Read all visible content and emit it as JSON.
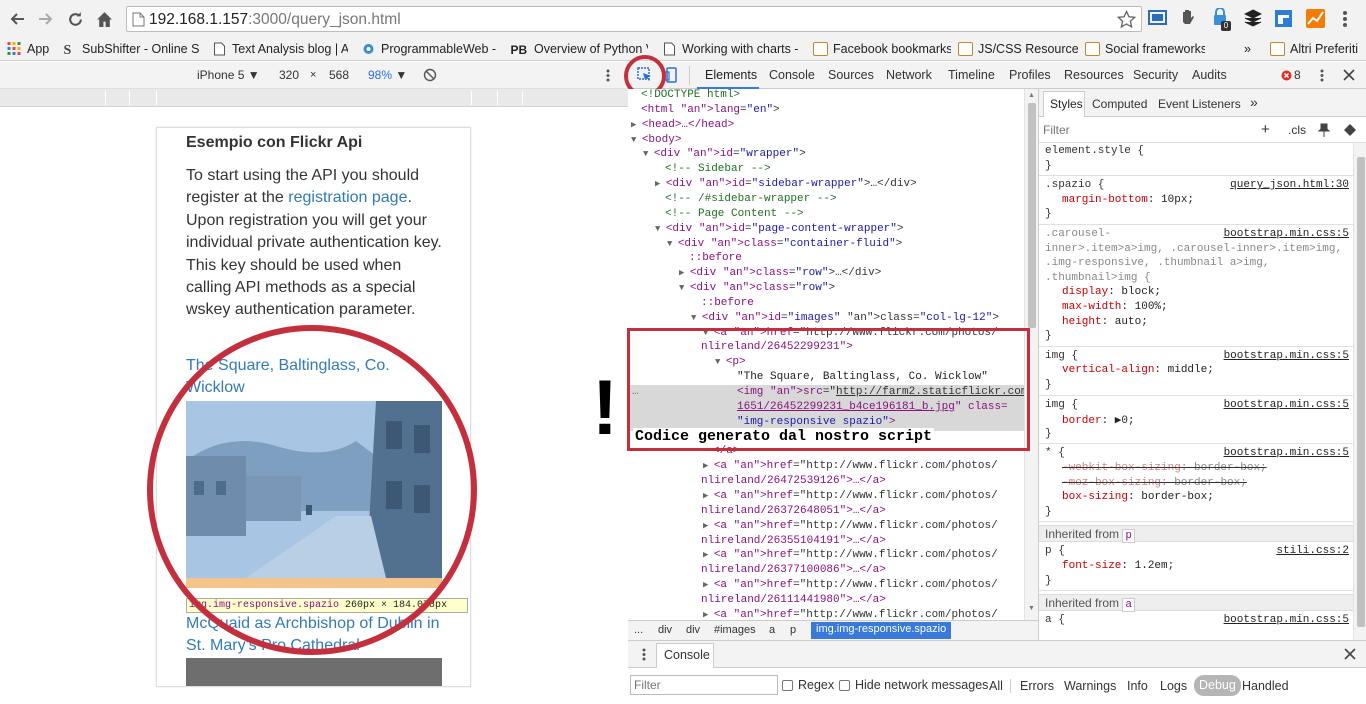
{
  "browser": {
    "url_host": "192.168.1.157",
    "url_path": ":3000/query_json.html",
    "bookmarks": [
      {
        "label": "App",
        "icon": "apps-grid-icon"
      },
      {
        "label": "SubShifter - Online SF",
        "icon": "subshifter-icon"
      },
      {
        "label": "Text Analysis blog | A",
        "icon": "page-icon"
      },
      {
        "label": "ProgrammableWeb -",
        "icon": "gear-icon"
      },
      {
        "label": "Overview of Python V",
        "icon": "pb-icon"
      },
      {
        "label": "Working with charts -",
        "icon": "page-icon"
      },
      {
        "label": "Facebook bookmarks",
        "icon": "folder-icon"
      },
      {
        "label": "JS/CSS Resources",
        "icon": "folder-icon"
      },
      {
        "label": "Social frameworks",
        "icon": "folder-icon"
      },
      {
        "label": "»",
        "icon": ""
      },
      {
        "label": "Altri Preferiti",
        "icon": "folder-icon"
      }
    ],
    "extension_badge": "0"
  },
  "device_toolbar": {
    "device": "iPhone 5",
    "width": "320",
    "times": "×",
    "height": "568",
    "zoom": "98%"
  },
  "page": {
    "heading": "Esempio con Flickr Api",
    "paragraph_before": "To start using the API you should register at the ",
    "registration_link": "registration page",
    "paragraph_after": ". Upon registration you will get your individual private authentication key. This key should be used when calling API methods as a special wskey authentication parameter.",
    "photo1_title": "The Square, Baltinglass, Co. Wicklow",
    "tooltip_selector": "img.img-responsive.spazio",
    "tooltip_size": "260px × 184.078px",
    "photo2_title": "McQuaid as Archbishop of Dublin in St. Mary's Pro Cathedral"
  },
  "devtools": {
    "tabs": [
      "Elements",
      "Console",
      "Sources",
      "Network",
      "Timeline",
      "Profiles",
      "Resources",
      "Security",
      "Audits"
    ],
    "error_count": "8",
    "dom_lines": [
      {
        "indent": 0,
        "tri": "",
        "t": "<!DOCTYPE html>",
        "k": "cm"
      },
      {
        "indent": 0,
        "tri": "",
        "t": "<html lang=\"en\">",
        "k": "tg"
      },
      {
        "indent": 0,
        "tri": "▶",
        "t": "<head>…</head>",
        "k": "tg"
      },
      {
        "indent": 0,
        "tri": "▼",
        "t": "<body>",
        "k": "tg"
      },
      {
        "indent": 1,
        "tri": "▼",
        "t": "<div id=\"wrapper\">",
        "k": "tg"
      },
      {
        "indent": 2,
        "tri": "",
        "t": "<!-- Sidebar -->",
        "k": "cm"
      },
      {
        "indent": 2,
        "tri": "▶",
        "t": "<div id=\"sidebar-wrapper\">…</div>",
        "k": "tg"
      },
      {
        "indent": 2,
        "tri": "",
        "t": "<!-- /#sidebar-wrapper -->",
        "k": "cm"
      },
      {
        "indent": 2,
        "tri": "",
        "t": "<!-- Page Content -->",
        "k": "cm"
      },
      {
        "indent": 2,
        "tri": "▼",
        "t": "<div id=\"page-content-wrapper\">",
        "k": "tg"
      },
      {
        "indent": 3,
        "tri": "▼",
        "t": "<div class=\"container-fluid\">",
        "k": "tg"
      },
      {
        "indent": 4,
        "tri": "",
        "t": "::before",
        "k": "tg"
      },
      {
        "indent": 4,
        "tri": "▶",
        "t": "<div class=\"row\">…</div>",
        "k": "tg"
      },
      {
        "indent": 4,
        "tri": "▼",
        "t": "<div class=\"row\">",
        "k": "tg"
      },
      {
        "indent": 5,
        "tri": "",
        "t": "::before",
        "k": "tg"
      },
      {
        "indent": 5,
        "tri": "▼",
        "t": "<div id=\"images\" class=\"col-lg-12\">",
        "k": "tg"
      },
      {
        "indent": 6,
        "tri": "▼",
        "t": "<a href=\"http://www.flickr.com/photos/",
        "k": "tg"
      },
      {
        "indent": 5,
        "tri": "",
        "t": "nlireland/26452299231\">",
        "k": "tg"
      },
      {
        "indent": 7,
        "tri": "▼",
        "t": "<p>",
        "k": "tg"
      },
      {
        "indent": 8,
        "tri": "",
        "t": "\"The Square, Baltinglass, Co. Wicklow\"",
        "k": "tx"
      },
      {
        "indent": 8,
        "tri": "",
        "t": "<img src=\"http://farm2.staticflickr.com/",
        "k": "tg"
      },
      {
        "indent": 8,
        "tri": "",
        "t": "1651/26452299231_b4ce196181_b.jpg\" class=",
        "k": "tg"
      },
      {
        "indent": 8,
        "tri": "",
        "t": "\"img-responsive spazio\">",
        "k": "tg"
      },
      {
        "indent": 7,
        "tri": "",
        "t": "",
        "k": "tg"
      },
      {
        "indent": 6,
        "tri": "",
        "t": "</a>",
        "k": "tg"
      },
      {
        "indent": 6,
        "tri": "▶",
        "t": "<a href=\"http://www.flickr.com/photos/",
        "k": "tg"
      },
      {
        "indent": 5,
        "tri": "",
        "t": "nlireland/26472539126\">…</a>",
        "k": "tg"
      },
      {
        "indent": 6,
        "tri": "▶",
        "t": "<a href=\"http://www.flickr.com/photos/",
        "k": "tg"
      },
      {
        "indent": 5,
        "tri": "",
        "t": "nlireland/26372648051\">…</a>",
        "k": "tg"
      },
      {
        "indent": 6,
        "tri": "▶",
        "t": "<a href=\"http://www.flickr.com/photos/",
        "k": "tg"
      },
      {
        "indent": 5,
        "tri": "",
        "t": "nlireland/26355104191\">…</a>",
        "k": "tg"
      },
      {
        "indent": 6,
        "tri": "▶",
        "t": "<a href=\"http://www.flickr.com/photos/",
        "k": "tg"
      },
      {
        "indent": 5,
        "tri": "",
        "t": "nlireland/26377100086\">…</a>",
        "k": "tg"
      },
      {
        "indent": 6,
        "tri": "▶",
        "t": "<a href=\"http://www.flickr.com/photos/",
        "k": "tg"
      },
      {
        "indent": 5,
        "tri": "",
        "t": "nlireland/26111441980\">…</a>",
        "k": "tg"
      },
      {
        "indent": 6,
        "tri": "▶",
        "t": "<a href=\"http://www.flickr.com/photos/",
        "k": "tg"
      }
    ],
    "annotation_text": "Codice generato dal nostro script",
    "exclamation": "!",
    "breadcrumbs": [
      "...",
      "div",
      "div",
      "#images",
      "a",
      "p",
      "img.img-responsive.spazio"
    ],
    "styles_tabs": [
      "Styles",
      "Computed",
      "Event Listeners",
      "»"
    ],
    "filter_placeholder": "Filter",
    "cls_label": ".cls",
    "rules": [
      {
        "selector": "element.style {",
        "source": "",
        "props": []
      },
      {
        "selector": ".spazio {",
        "source": "query_json.html:30",
        "props": [
          {
            "n": "margin-bottom",
            "v": "10px;"
          }
        ]
      },
      {
        "selector": ".carousel-inner>.item>a>img, .carousel-inner>.item>img, .img-responsive, .thumbnail a>img, .thumbnail>img {",
        "source": "bootstrap.min.css:5",
        "props": [
          {
            "n": "display",
            "v": "block;"
          },
          {
            "n": "max-width",
            "v": "100%;"
          },
          {
            "n": "height",
            "v": "auto;"
          }
        ]
      },
      {
        "selector": "img {",
        "source": "bootstrap.min.css:5",
        "props": [
          {
            "n": "vertical-align",
            "v": "middle;"
          }
        ]
      },
      {
        "selector": "img {",
        "source": "bootstrap.min.css:5",
        "props": [
          {
            "n": "border",
            "v": "▶0;"
          }
        ]
      },
      {
        "selector": "* {",
        "source": "bootstrap.min.css:5",
        "props": [
          {
            "n": "-webkit-box-sizing",
            "v": "border-box;",
            "strike": true
          },
          {
            "n": "-moz-box-sizing",
            "v": "border-box;",
            "strike": true
          },
          {
            "n": "box-sizing",
            "v": "border-box;"
          }
        ]
      },
      {
        "selector": "p {",
        "source": "stili.css:2",
        "props": [
          {
            "n": "font-size",
            "v": "1.2em;"
          }
        ]
      },
      {
        "selector": "a {",
        "source": "bootstrap.min.css:5",
        "props": []
      }
    ],
    "inherited_p": "Inherited from",
    "inherited_p_tag": "p",
    "inherited_a": "Inherited from",
    "inherited_a_tag": "a",
    "drawer_tab": "Console",
    "console_filter": "Filter",
    "regex": "Regex",
    "hide_network": "Hide network messages",
    "levels": [
      "All",
      "Errors",
      "Warnings",
      "Info",
      "Logs",
      "Debug",
      "Handled"
    ]
  },
  "colors": {
    "accent": "#c42f3e",
    "link": "#337ab7",
    "tag": "#881280",
    "attr": "#994500",
    "value": "#1a1aa6",
    "comment": "#236e25",
    "prop": "#c80000"
  }
}
